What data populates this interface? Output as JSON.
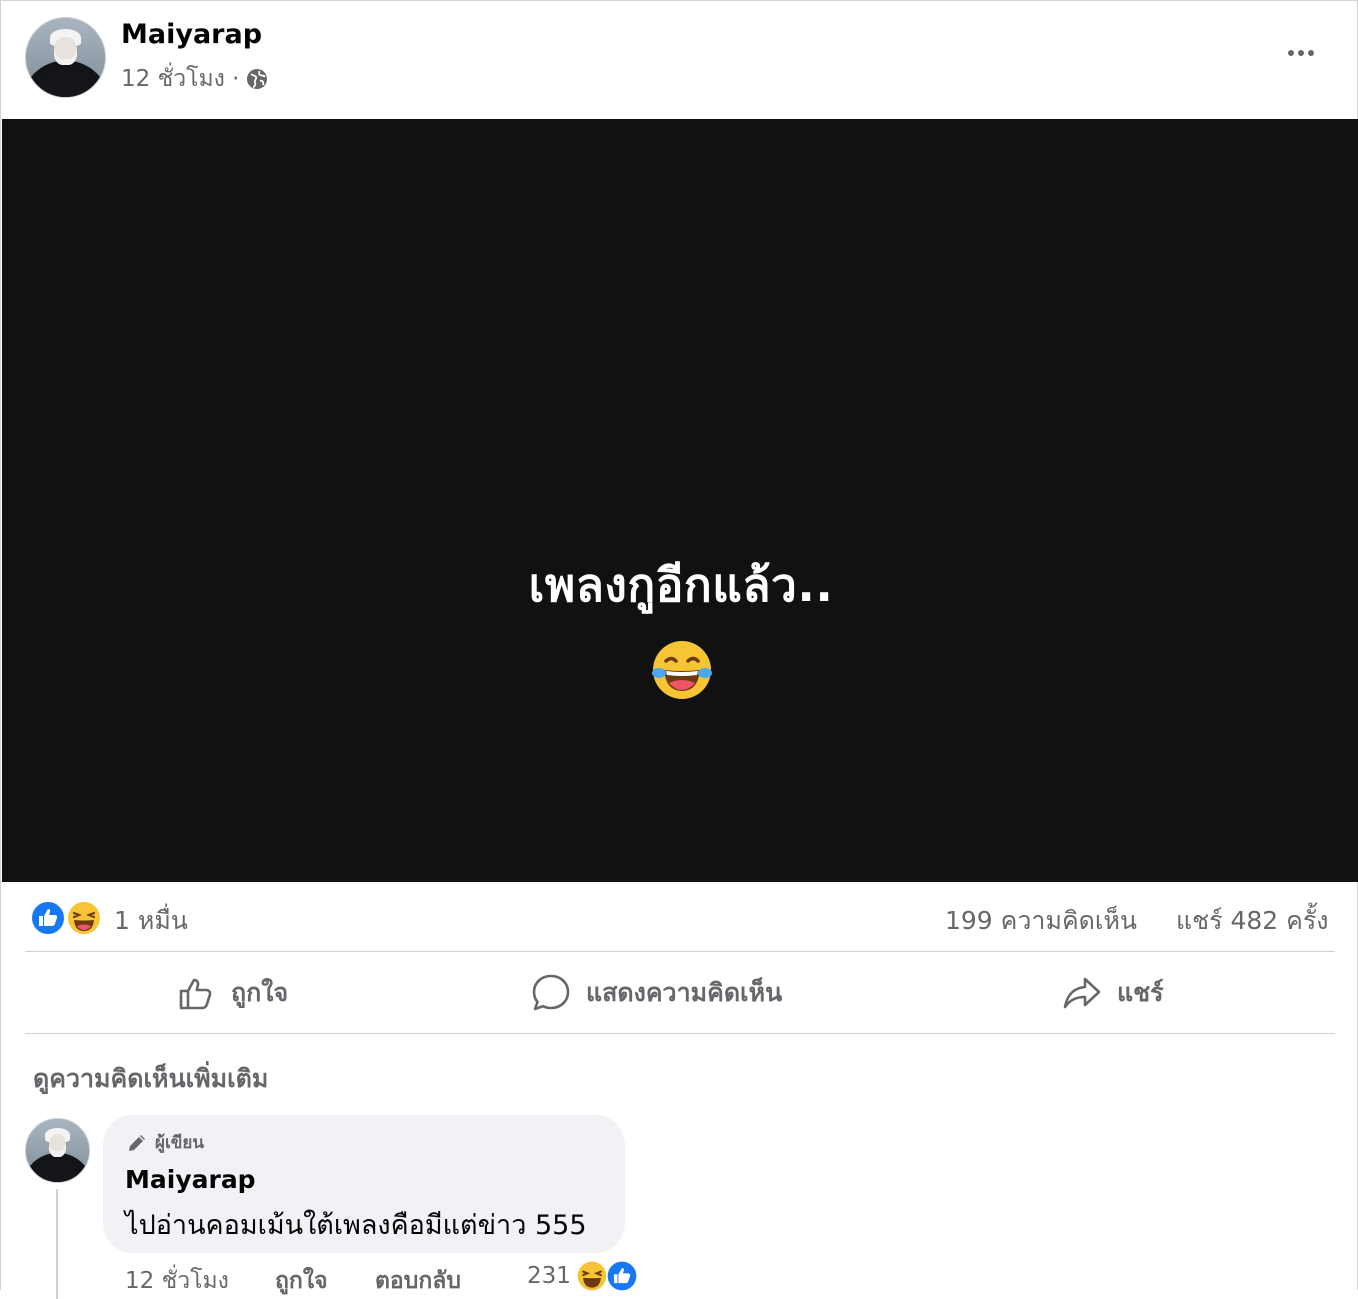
{
  "post": {
    "author": "Maiyarap",
    "time": "12 ชั่วโมง ·",
    "privacy_icon": "globe-icon",
    "more_icon": "more-options-icon",
    "media_text": "เพลงกูอีกแล้ว..",
    "media_emoji": "laughing-tears-emoji",
    "media_background": "#111112"
  },
  "stats": {
    "reactions": "1 หมื่น",
    "reaction_icons": [
      "like-icon",
      "haha-icon"
    ],
    "comments": "199 ความคิดเห็น",
    "shares": "แชร์ 482 ครั้ง"
  },
  "actions": {
    "like": "ถูกใจ",
    "comment": "แสดงความคิดเห็น",
    "share": "แชร์"
  },
  "comments_section": {
    "more_comments": "ดูความคิดเห็นเพิ่มเติม",
    "items": [
      {
        "badge": "ผู้เขียน",
        "name": "Maiyarap",
        "text": "ไปอ่านคอมเม้นใต้เพลงคือมีแต่ข่าว 555",
        "time": "12 ชั่วโมง",
        "like": "ถูกใจ",
        "reply": "ตอบกลับ",
        "reaction_count": "231"
      }
    ]
  },
  "colors": {
    "like_blue": "#1877f2",
    "haha_yellow": "#f7c533",
    "secondary_text": "#65676b"
  }
}
